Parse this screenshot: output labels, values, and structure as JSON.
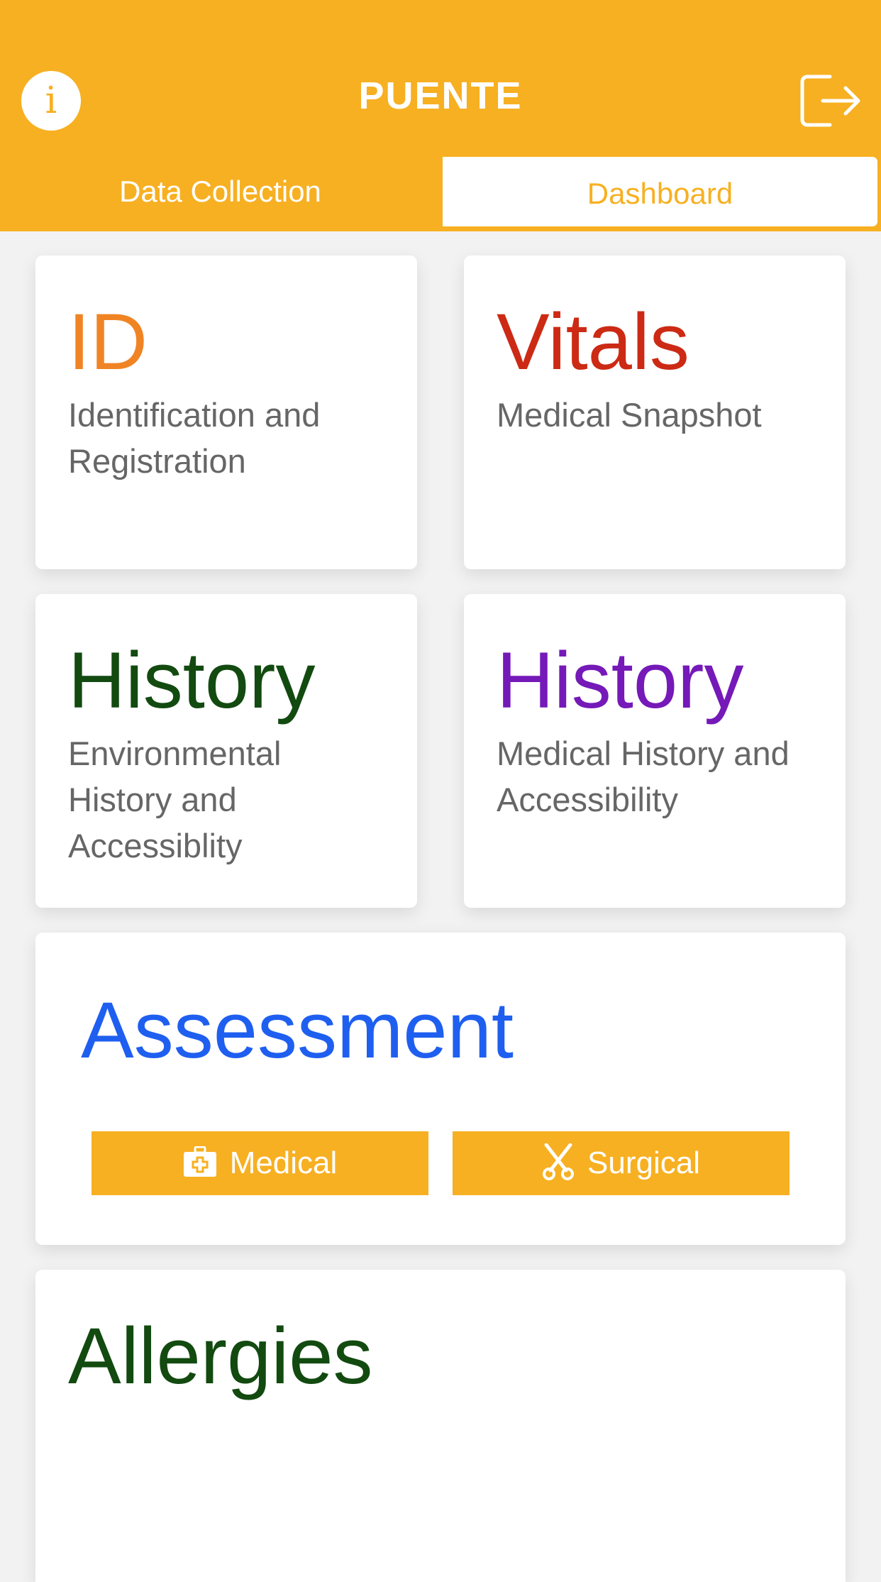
{
  "header": {
    "title": "PUENTE",
    "info_icon": "i",
    "background_color": "#f7b022"
  },
  "tabs": [
    {
      "label": "Data Collection",
      "active": true
    },
    {
      "label": "Dashboard",
      "active": false
    }
  ],
  "cards": {
    "id": {
      "title": "ID",
      "subtitle": "Identification and Registration",
      "title_color": "#f08424"
    },
    "vitals": {
      "title": "Vitals",
      "subtitle": "Medical Snapshot",
      "title_color": "#cc2a14"
    },
    "env_history": {
      "title": "History",
      "subtitle": "Environmental History and Accessiblity",
      "title_color": "#124a10"
    },
    "med_history": {
      "title": "History",
      "subtitle": "Medical History and Accessibility",
      "title_color": "#7519b8"
    },
    "assessment": {
      "title": "Assessment",
      "title_color": "#1f5ff0",
      "buttons": [
        {
          "label": "Medical",
          "icon": "medical-kit-icon"
        },
        {
          "label": "Surgical",
          "icon": "scissors-icon"
        }
      ]
    },
    "allergies": {
      "title": "Allergies",
      "title_color": "#124a10"
    }
  },
  "colors": {
    "accent": "#f7b022",
    "subtitle_gray": "#666666"
  }
}
